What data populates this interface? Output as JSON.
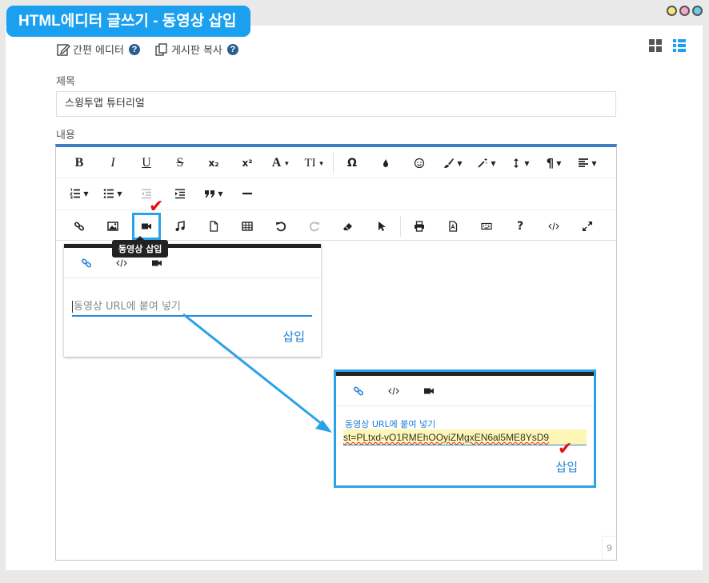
{
  "header": {
    "title": "HTML에디터 글쓰기 - 동영상 삽입"
  },
  "window_dots": [
    "#f5e87a",
    "#f5a9c8",
    "#66ccf0"
  ],
  "topbar": {
    "simple_editor": "간편 에디터",
    "board_copy": "게시판 복사",
    "help_glyph": "?"
  },
  "form": {
    "title_label": "제목",
    "title_value": "스윙투앱 튜터리얼",
    "content_label": "내용"
  },
  "toolbar": {
    "row1": [
      "bold-button",
      "italic-button",
      "underline-button",
      "strikethrough-button",
      "subscript-button",
      "superscript-button",
      "font-color-button",
      "font-size-button",
      "special-char-button",
      "highlight-button",
      "emoji-button",
      "paint-button",
      "magic-button",
      "line-height-button",
      "paragraph-button",
      "align-button"
    ],
    "labels": {
      "bold": "B",
      "italic": "I",
      "underline": "U",
      "strike": "S",
      "sub": "x₂",
      "sup": "x²",
      "font": "A",
      "size": "TI",
      "omega": "Ω",
      "para": "¶"
    }
  },
  "tooltip": {
    "video_insert": "동영상 삽입"
  },
  "popover1": {
    "placeholder": "동영상 URL에 붙여 넣기",
    "insert": "삽입"
  },
  "popover2": {
    "caption": "동영상 URL에 붙여 넣기",
    "value": "st=PLtxd-vO1RMEhOOyiZMgxEN6al5ME8YsD9",
    "insert": "삽입"
  },
  "editor": {
    "char_count": "9"
  },
  "colors": {
    "accent": "#1aa0ef",
    "link": "#1a7ed8",
    "check": "#e01010"
  }
}
